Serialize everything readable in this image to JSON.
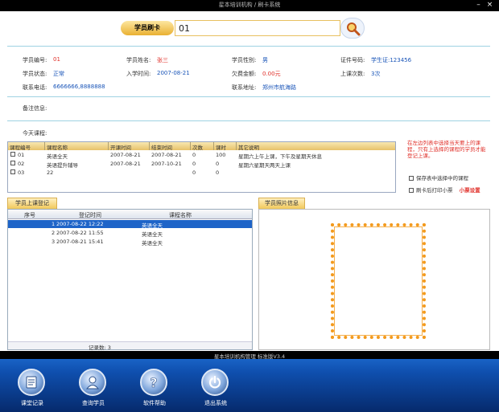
{
  "window": {
    "title": "星本培训机构 / 刷卡系统",
    "controls": [
      "minimize",
      "close"
    ]
  },
  "card": {
    "label": "学员刷卡",
    "value": "01"
  },
  "student": {
    "id_label": "学员编号:",
    "id_value": "01",
    "name_label": "学员姓名:",
    "name_value": "张三",
    "gender_label": "学员性别:",
    "gender_value": "男",
    "idcard_label": "证件号码:",
    "idcard_value": "学生证:123456",
    "status_label": "学员状态:",
    "status_value": "正常",
    "enroll_label": "入学时间:",
    "enroll_value": "2007-08-21",
    "owed_label": "欠费金额:",
    "owed_value": "0.00元",
    "classes_label": "上课次数:",
    "classes_value": "3次",
    "phone_label": "联系电话:",
    "phone_value": "6666666,8888888",
    "address_label": "联系地址:",
    "address_value": "郑州市航海路",
    "remarks_label": "备注信息:"
  },
  "today": {
    "label": "今天课程:",
    "headers": [
      "课程编号",
      "课程名称",
      "开课时间",
      "结束时间",
      "次数",
      "课时",
      "其它说明"
    ],
    "rows": [
      {
        "code": "01",
        "name": "英语全天",
        "start": "2007-08-21",
        "end": "2007-08-21",
        "count": "0",
        "hours": "100",
        "note": "星期六上午上课，下午及星期天休息"
      },
      {
        "code": "02",
        "name": "英语提升辅导",
        "start": "2007-08-21",
        "end": "2007-10-21",
        "count": "0",
        "hours": "0",
        "note": "星期六星期天两天上课"
      },
      {
        "code": "03",
        "name": "22",
        "start": "",
        "end": "",
        "count": "0",
        "hours": "0",
        "note": ""
      }
    ],
    "side_note": "在左边列表中选择当天要上的课程，只有上选择的课程的学员才能登记上课。",
    "option_save": "保存表中选择中的课程",
    "option_print": "刷卡后打印小票",
    "option_print_link": "小票设置"
  },
  "checkin": {
    "tab_label": "学员上课登记",
    "headers": [
      "序号",
      "登记时间",
      "课程名称"
    ],
    "rows": [
      {
        "no": "1",
        "time": "2007-08-22 12:22",
        "course": "英语全天"
      },
      {
        "no": "2",
        "time": "2007-08-22 11:55",
        "course": "英语全天"
      },
      {
        "no": "3",
        "time": "2007-08-21 15:41",
        "course": "英语全天"
      }
    ],
    "footer": "记录数: 3"
  },
  "photo": {
    "tab_label": "学员照片信息"
  },
  "taskbar": {
    "title": "星本培训机构管理 标准版V3.4",
    "items": [
      {
        "label": "课堂记录",
        "icon": "record-icon"
      },
      {
        "label": "查询学员",
        "icon": "search-user-icon"
      },
      {
        "label": "软件帮助",
        "icon": "help-icon"
      },
      {
        "label": "退出系统",
        "icon": "power-icon"
      }
    ]
  },
  "colors": {
    "accent": "#f0b43c",
    "highlight": "#1e64c8",
    "alert": "#e0302a",
    "taskbar": "#0f4fae"
  }
}
